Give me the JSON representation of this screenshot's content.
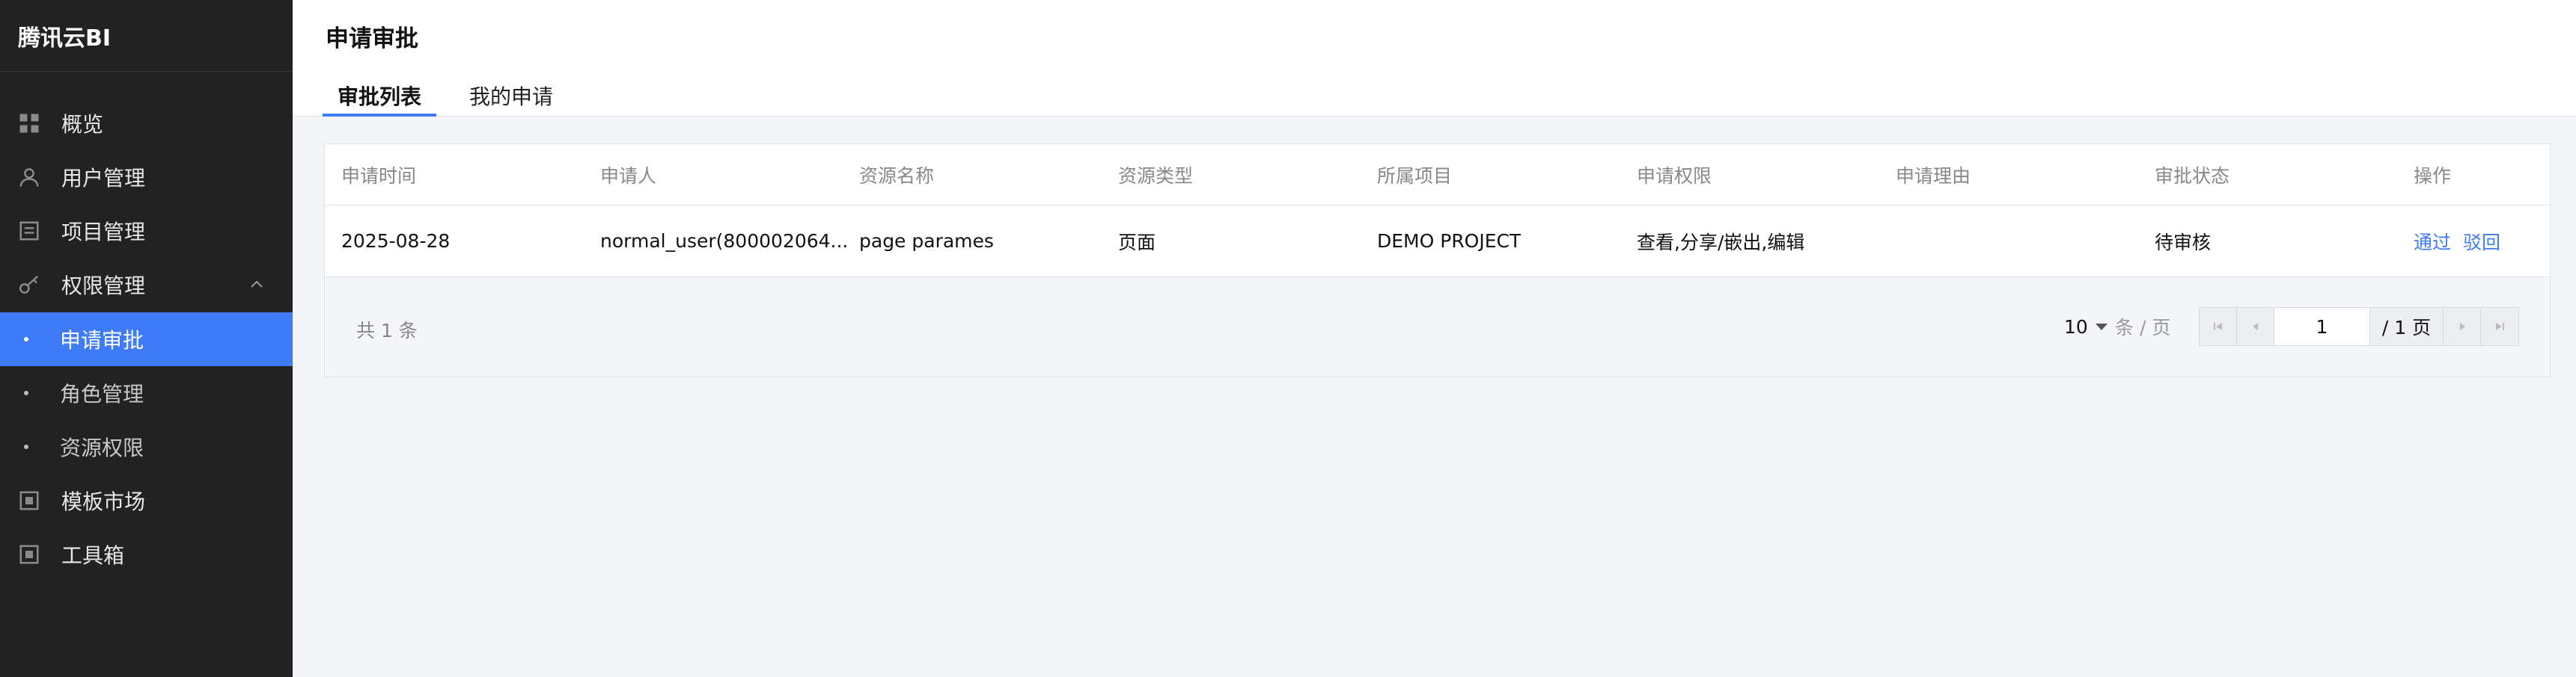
{
  "sidebar": {
    "brand": "腾讯云BI",
    "items": [
      {
        "label": "概览",
        "icon": "dashboard-icon"
      },
      {
        "label": "用户管理",
        "icon": "user-icon"
      },
      {
        "label": "项目管理",
        "icon": "project-icon"
      },
      {
        "label": "权限管理",
        "icon": "key-icon"
      },
      {
        "label": "模板市场",
        "icon": "template-icon"
      },
      {
        "label": "工具箱",
        "icon": "toolbox-icon"
      }
    ],
    "sub_items": [
      {
        "label": "申请审批",
        "active": true
      },
      {
        "label": "角色管理",
        "active": false
      },
      {
        "label": "资源权限",
        "active": false
      }
    ]
  },
  "header": {
    "title": "申请审批",
    "tabs": [
      {
        "label": "审批列表",
        "active": true
      },
      {
        "label": "我的申请",
        "active": false
      }
    ]
  },
  "table": {
    "columns": [
      "申请时间",
      "申请人",
      "资源名称",
      "资源类型",
      "所属项目",
      "申请权限",
      "申请理由",
      "审批状态",
      "操作"
    ],
    "rows": [
      {
        "time": "2025-08-28",
        "applicant": "normal_user(800002064...",
        "resource_name": "page parames",
        "resource_type": "页面",
        "project": "DEMO PROJECT",
        "permission": "查看,分享/嵌出,编辑",
        "reason": "",
        "status": "待审核",
        "actions": [
          "通过",
          "驳回"
        ]
      }
    ]
  },
  "pagination": {
    "total_text": "共 1 条",
    "page_size": "10",
    "per_page_text": "条 / 页",
    "current_page": "1",
    "total_pages_text": "/ 1 页"
  },
  "colors": {
    "accent": "#3e7bfa",
    "sidebar_bg": "#222222"
  }
}
